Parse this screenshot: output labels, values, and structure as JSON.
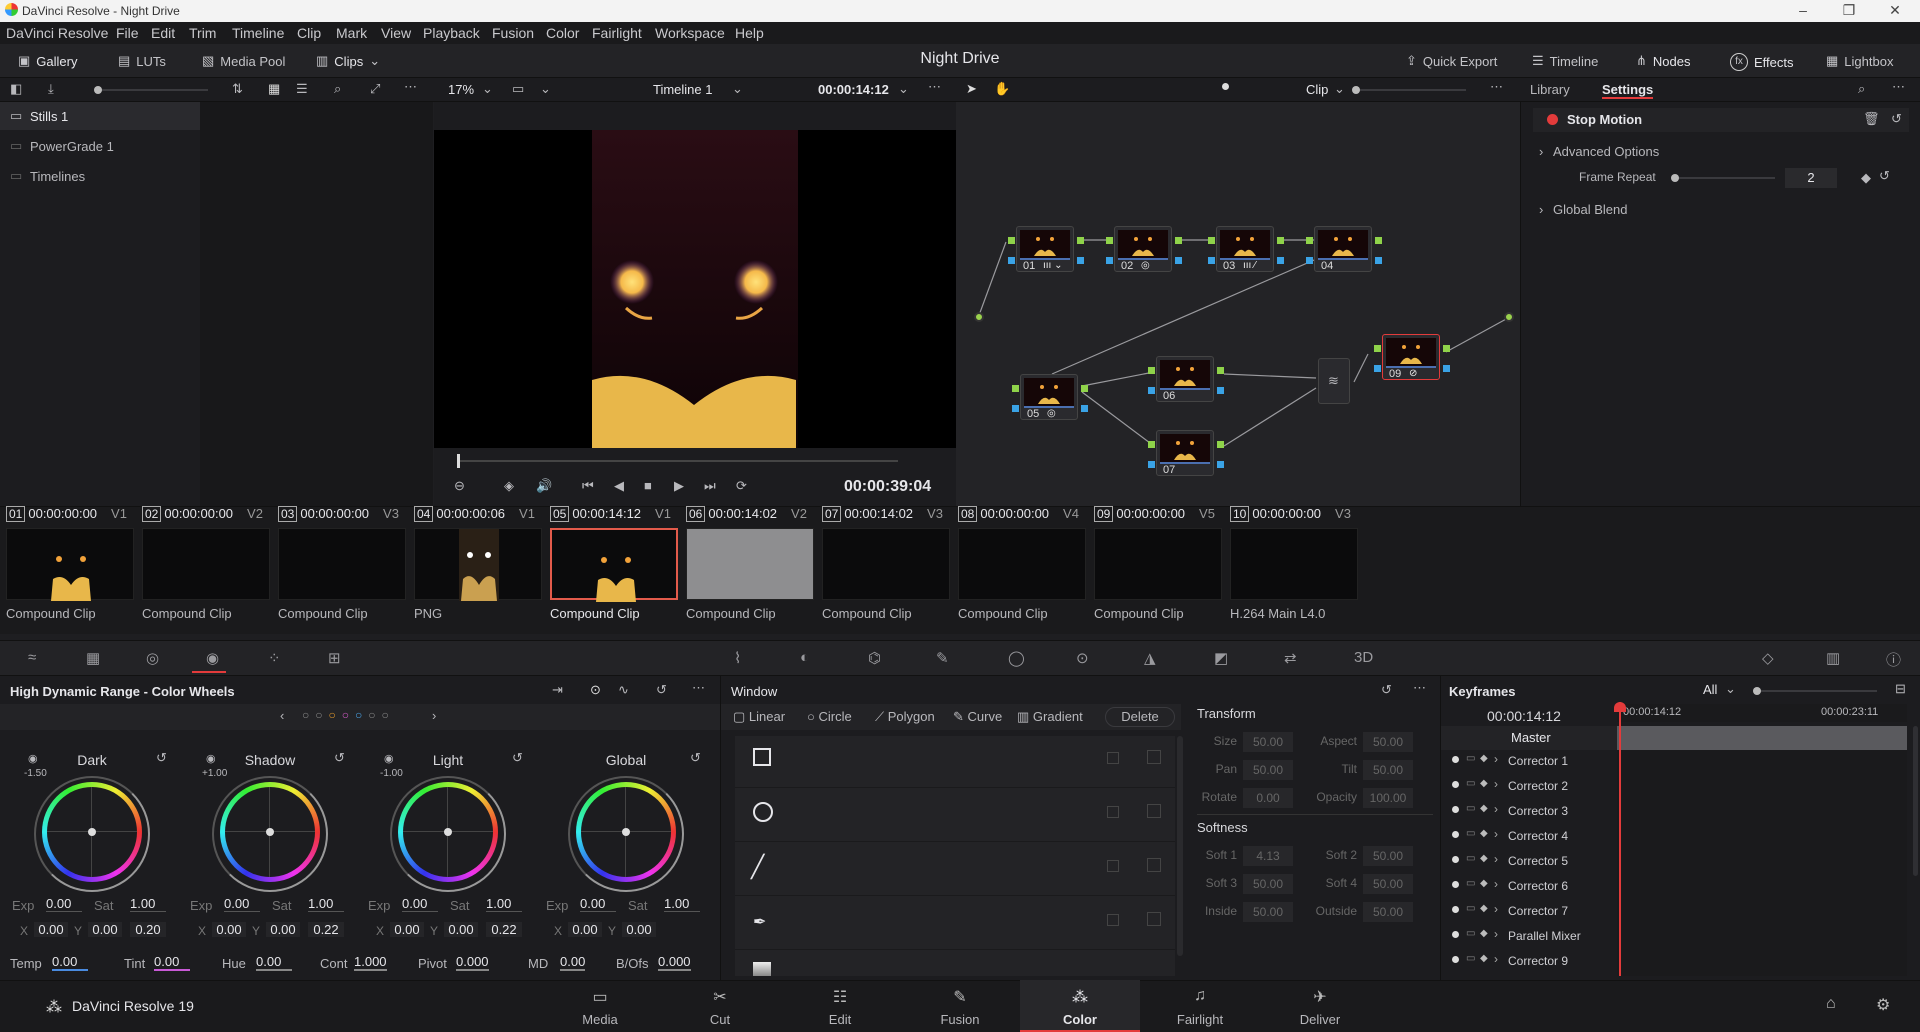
{
  "window": {
    "title": "DaVinci Resolve - Night Drive"
  },
  "menu": [
    "DaVinci Resolve",
    "File",
    "Edit",
    "Trim",
    "Timeline",
    "Clip",
    "Mark",
    "View",
    "Playback",
    "Fusion",
    "Color",
    "Fairlight",
    "Workspace",
    "Help"
  ],
  "toolbar": {
    "gallery": "Gallery",
    "luts": "LUTs",
    "media_pool": "Media Pool",
    "clips": "Clips",
    "project": "Night Drive",
    "quick_export": "Quick Export",
    "timeline": "Timeline",
    "nodes": "Nodes",
    "effects": "Effects",
    "lightbox": "Lightbox"
  },
  "viewer": {
    "zoom": "17%",
    "timeline": "Timeline 1",
    "timecode": "00:00:14:12",
    "duration": "00:00:39:04"
  },
  "node_editor": {
    "mode": "Clip"
  },
  "gallery": {
    "items": [
      "Stills 1",
      "PowerGrade 1",
      "Timelines"
    ]
  },
  "effects_panel": {
    "tab_library": "Library",
    "tab_settings": "Settings",
    "effect": "Stop Motion",
    "advanced": "Advanced Options",
    "frame_repeat_label": "Frame Repeat",
    "frame_repeat_value": "2",
    "global_blend": "Global Blend"
  },
  "nodes": [
    {
      "id": "01"
    },
    {
      "id": "02"
    },
    {
      "id": "03"
    },
    {
      "id": "04"
    },
    {
      "id": "05"
    },
    {
      "id": "06"
    },
    {
      "id": "07"
    },
    {
      "id": "09"
    }
  ],
  "clips": [
    {
      "num": "01",
      "tc": "00:00:00:00",
      "track": "V1",
      "name": "Compound Clip"
    },
    {
      "num": "02",
      "tc": "00:00:00:00",
      "track": "V2",
      "name": "Compound Clip"
    },
    {
      "num": "03",
      "tc": "00:00:00:00",
      "track": "V3",
      "name": "Compound Clip"
    },
    {
      "num": "04",
      "tc": "00:00:00:06",
      "track": "V1",
      "name": "PNG"
    },
    {
      "num": "05",
      "tc": "00:00:14:12",
      "track": "V1",
      "name": "Compound Clip"
    },
    {
      "num": "06",
      "tc": "00:00:14:02",
      "track": "V2",
      "name": "Compound Clip"
    },
    {
      "num": "07",
      "tc": "00:00:14:02",
      "track": "V3",
      "name": "Compound Clip"
    },
    {
      "num": "08",
      "tc": "00:00:00:00",
      "track": "V4",
      "name": "Compound Clip"
    },
    {
      "num": "09",
      "tc": "00:00:00:00",
      "track": "V5",
      "name": "Compound Clip"
    },
    {
      "num": "10",
      "tc": "00:00:00:00",
      "track": "V3",
      "name": "H.264 Main L4.0"
    }
  ],
  "hdr": {
    "title": "High Dynamic Range - Color Wheels",
    "wheels": [
      {
        "name": "Dark",
        "zone": "-1.50",
        "exp": "0.00",
        "sat": "1.00",
        "x": "0.00",
        "y": "0.00",
        "z": "0.20"
      },
      {
        "name": "Shadow",
        "zone": "+1.00",
        "exp": "0.00",
        "sat": "1.00",
        "x": "0.00",
        "y": "0.00",
        "z": "0.22"
      },
      {
        "name": "Light",
        "zone": "-1.00",
        "exp": "0.00",
        "sat": "1.00",
        "x": "0.00",
        "y": "0.00",
        "z": "0.22"
      },
      {
        "name": "Global",
        "zone": "",
        "exp": "0.00",
        "sat": "1.00",
        "x": "0.00",
        "y": "0.00",
        "z": ""
      }
    ],
    "labels": {
      "exp": "Exp",
      "sat": "Sat",
      "x": "X",
      "y": "Y"
    },
    "bottom": {
      "temp_l": "Temp",
      "temp": "0.00",
      "tint_l": "Tint",
      "tint": "0.00",
      "hue_l": "Hue",
      "hue": "0.00",
      "cont_l": "Cont",
      "cont": "1.000",
      "pivot_l": "Pivot",
      "pivot": "0.000",
      "md_l": "MD",
      "md": "0.00",
      "bofs_l": "B/Ofs",
      "bofs": "0.000"
    }
  },
  "window_panel": {
    "title": "Window",
    "linear": "Linear",
    "circle": "Circle",
    "polygon": "Polygon",
    "curve": "Curve",
    "gradient": "Gradient",
    "delete": "Delete",
    "transform": "Transform",
    "size_l": "Size",
    "size": "50.00",
    "aspect_l": "Aspect",
    "aspect": "50.00",
    "pan_l": "Pan",
    "pan": "50.00",
    "tilt_l": "Tilt",
    "tilt": "50.00",
    "rotate_l": "Rotate",
    "rotate": "0.00",
    "opacity_l": "Opacity",
    "opacity": "100.00",
    "softness": "Softness",
    "soft1_l": "Soft 1",
    "soft1": "4.13",
    "soft2_l": "Soft 2",
    "soft2": "50.00",
    "soft3_l": "Soft 3",
    "soft3": "50.00",
    "soft4_l": "Soft 4",
    "soft4": "50.00",
    "inside_l": "Inside",
    "inside": "50.00",
    "outside_l": "Outside",
    "outside": "50.00"
  },
  "keyframes": {
    "title": "Keyframes",
    "filter": "All",
    "tc": "00:00:14:12",
    "ruler1": "00:00:14:12",
    "ruler2": "00:00:23:11",
    "master": "Master",
    "rows": [
      "Corrector 1",
      "Corrector 2",
      "Corrector 3",
      "Corrector 4",
      "Corrector 5",
      "Corrector 6",
      "Corrector 7",
      "Parallel Mixer",
      "Corrector 9"
    ]
  },
  "pages": {
    "brand": "DaVinci Resolve 19",
    "items": [
      "Media",
      "Cut",
      "Edit",
      "Fusion",
      "Color",
      "Fairlight",
      "Deliver"
    ],
    "active": "Color"
  },
  "colors": {
    "accent": "#e33b3b",
    "node_output": "#8fd34a",
    "node_input": "#3aa3e6"
  }
}
